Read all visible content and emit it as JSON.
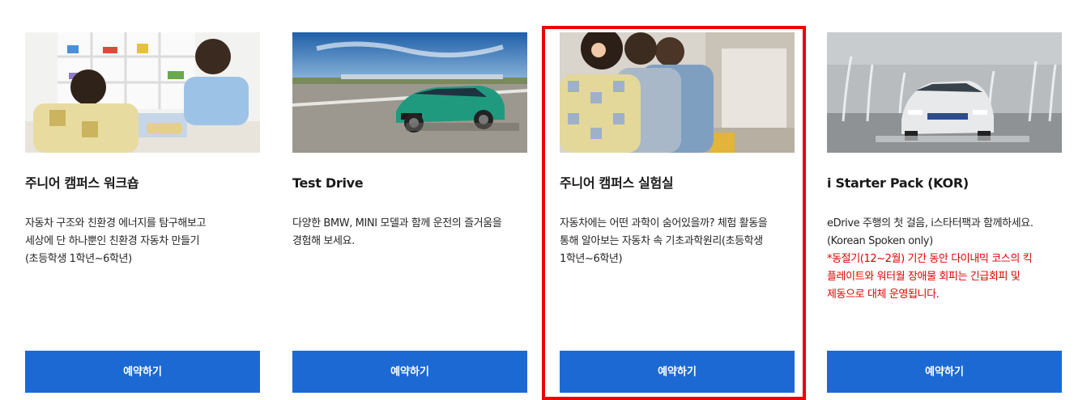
{
  "cards": [
    {
      "image_alt": "Children building models at a workshop table",
      "title": "주니어 캠퍼스 워크숍",
      "desc_lines": [
        "자동차 구조와 친환경 에너지를 탐구해보고",
        "세상에 단 하나뿐인 친환경 자동차 만들기",
        "(초등학생 1학년~6학년)"
      ],
      "note_lines": [],
      "button_label": "예약하기"
    },
    {
      "image_alt": "Green BMW sedan on a test track",
      "title": "Test Drive",
      "desc_lines": [
        "다양한 BMW, MINI 모델과 함께 운전의 즐거움을",
        "경험해 보세요."
      ],
      "note_lines": [],
      "button_label": "예약하기"
    },
    {
      "image_alt": "Children exploring a science exhibit",
      "title": "주니어 캠퍼스 실험실",
      "desc_lines": [
        "자동차에는 어떤 과학이 숨어있을까? 체험 활동을",
        "통해 알아보는 자동차 속 기초과학원리(초등학생",
        "1학년~6학년)"
      ],
      "note_lines": [],
      "button_label": "예약하기"
    },
    {
      "image_alt": "White BMW i4 driving through water fountains",
      "title": "i Starter Pack (KOR)",
      "desc_lines": [
        "eDrive 주행의 첫 걸음, i스타터팩과 함께하세요.",
        "(Korean Spoken only)"
      ],
      "note_lines": [
        "*동절기(12~2월) 기간 동안 다이내믹 코스의 킥",
        "플레이트와 워터월 장애물 회피는 긴급회피 및",
        "제동으로 대체 운영됩니다."
      ],
      "button_label": "예약하기"
    }
  ],
  "colors": {
    "button": "#1c69d4",
    "button_text": "#ffffff",
    "note": "#e00000",
    "highlight": "#ee0000"
  }
}
